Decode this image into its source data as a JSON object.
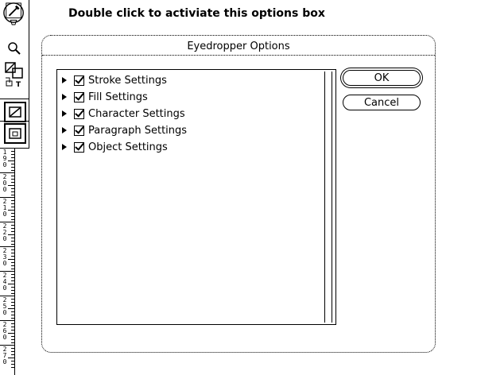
{
  "annotation": "Double click to activiate this options box",
  "dialog": {
    "title": "Eyedropper Options",
    "items": [
      {
        "label": "Stroke Settings",
        "checked": true
      },
      {
        "label": "Fill Settings",
        "checked": true
      },
      {
        "label": "Character Settings",
        "checked": true
      },
      {
        "label": "Paragraph Settings",
        "checked": true
      },
      {
        "label": "Object Settings",
        "checked": true
      }
    ],
    "ok_label": "OK",
    "cancel_label": "Cancel"
  },
  "toolbar": {
    "tools": [
      "eyedropper-icon",
      "zoom-icon",
      "swap-colors-icon",
      "fill-stroke-icon",
      "frame-icon"
    ],
    "text_tool_label": "T"
  },
  "ruler": {
    "labels": [
      "190",
      "200",
      "210",
      "220",
      "230",
      "240",
      "250",
      "260",
      "270"
    ]
  }
}
